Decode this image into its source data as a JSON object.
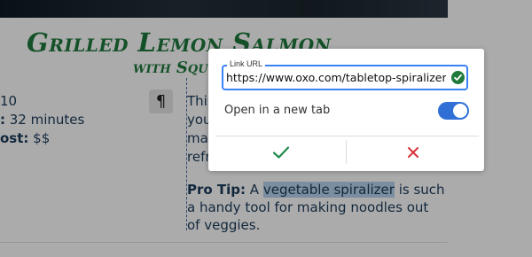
{
  "recipe": {
    "title": "Grilled Lemon Salmon",
    "subtitle": "with Squ",
    "meta": [
      {
        "label": "",
        "value": "10"
      },
      {
        "label": ":",
        "value": " 32 minutes"
      },
      {
        "label": "ost:",
        "value": " $$"
      }
    ],
    "body_lines": [
      "This",
      "you",
      "mak",
      "refre"
    ],
    "pro_tip": {
      "label": "Pro Tip:",
      "before": " A ",
      "highlight": "vegetable spiralizer",
      "after": " is such",
      "line2": "a handy tool for making noodles out",
      "line3": "of veggies."
    },
    "pilcrow": "¶"
  },
  "link_popup": {
    "legend": "Link URL",
    "url": "https://www.oxo.com/tabletop-spiralizer.html",
    "open_in_new_tab_label": "Open in a new tab",
    "open_in_new_tab": true,
    "confirm_icon": "checkmark-icon",
    "cancel_icon": "close-icon",
    "colors": {
      "accent": "#3b82f6",
      "toggle": "#2f6fd6",
      "confirm": "#1f8a4c",
      "cancel": "#d9343a"
    }
  }
}
